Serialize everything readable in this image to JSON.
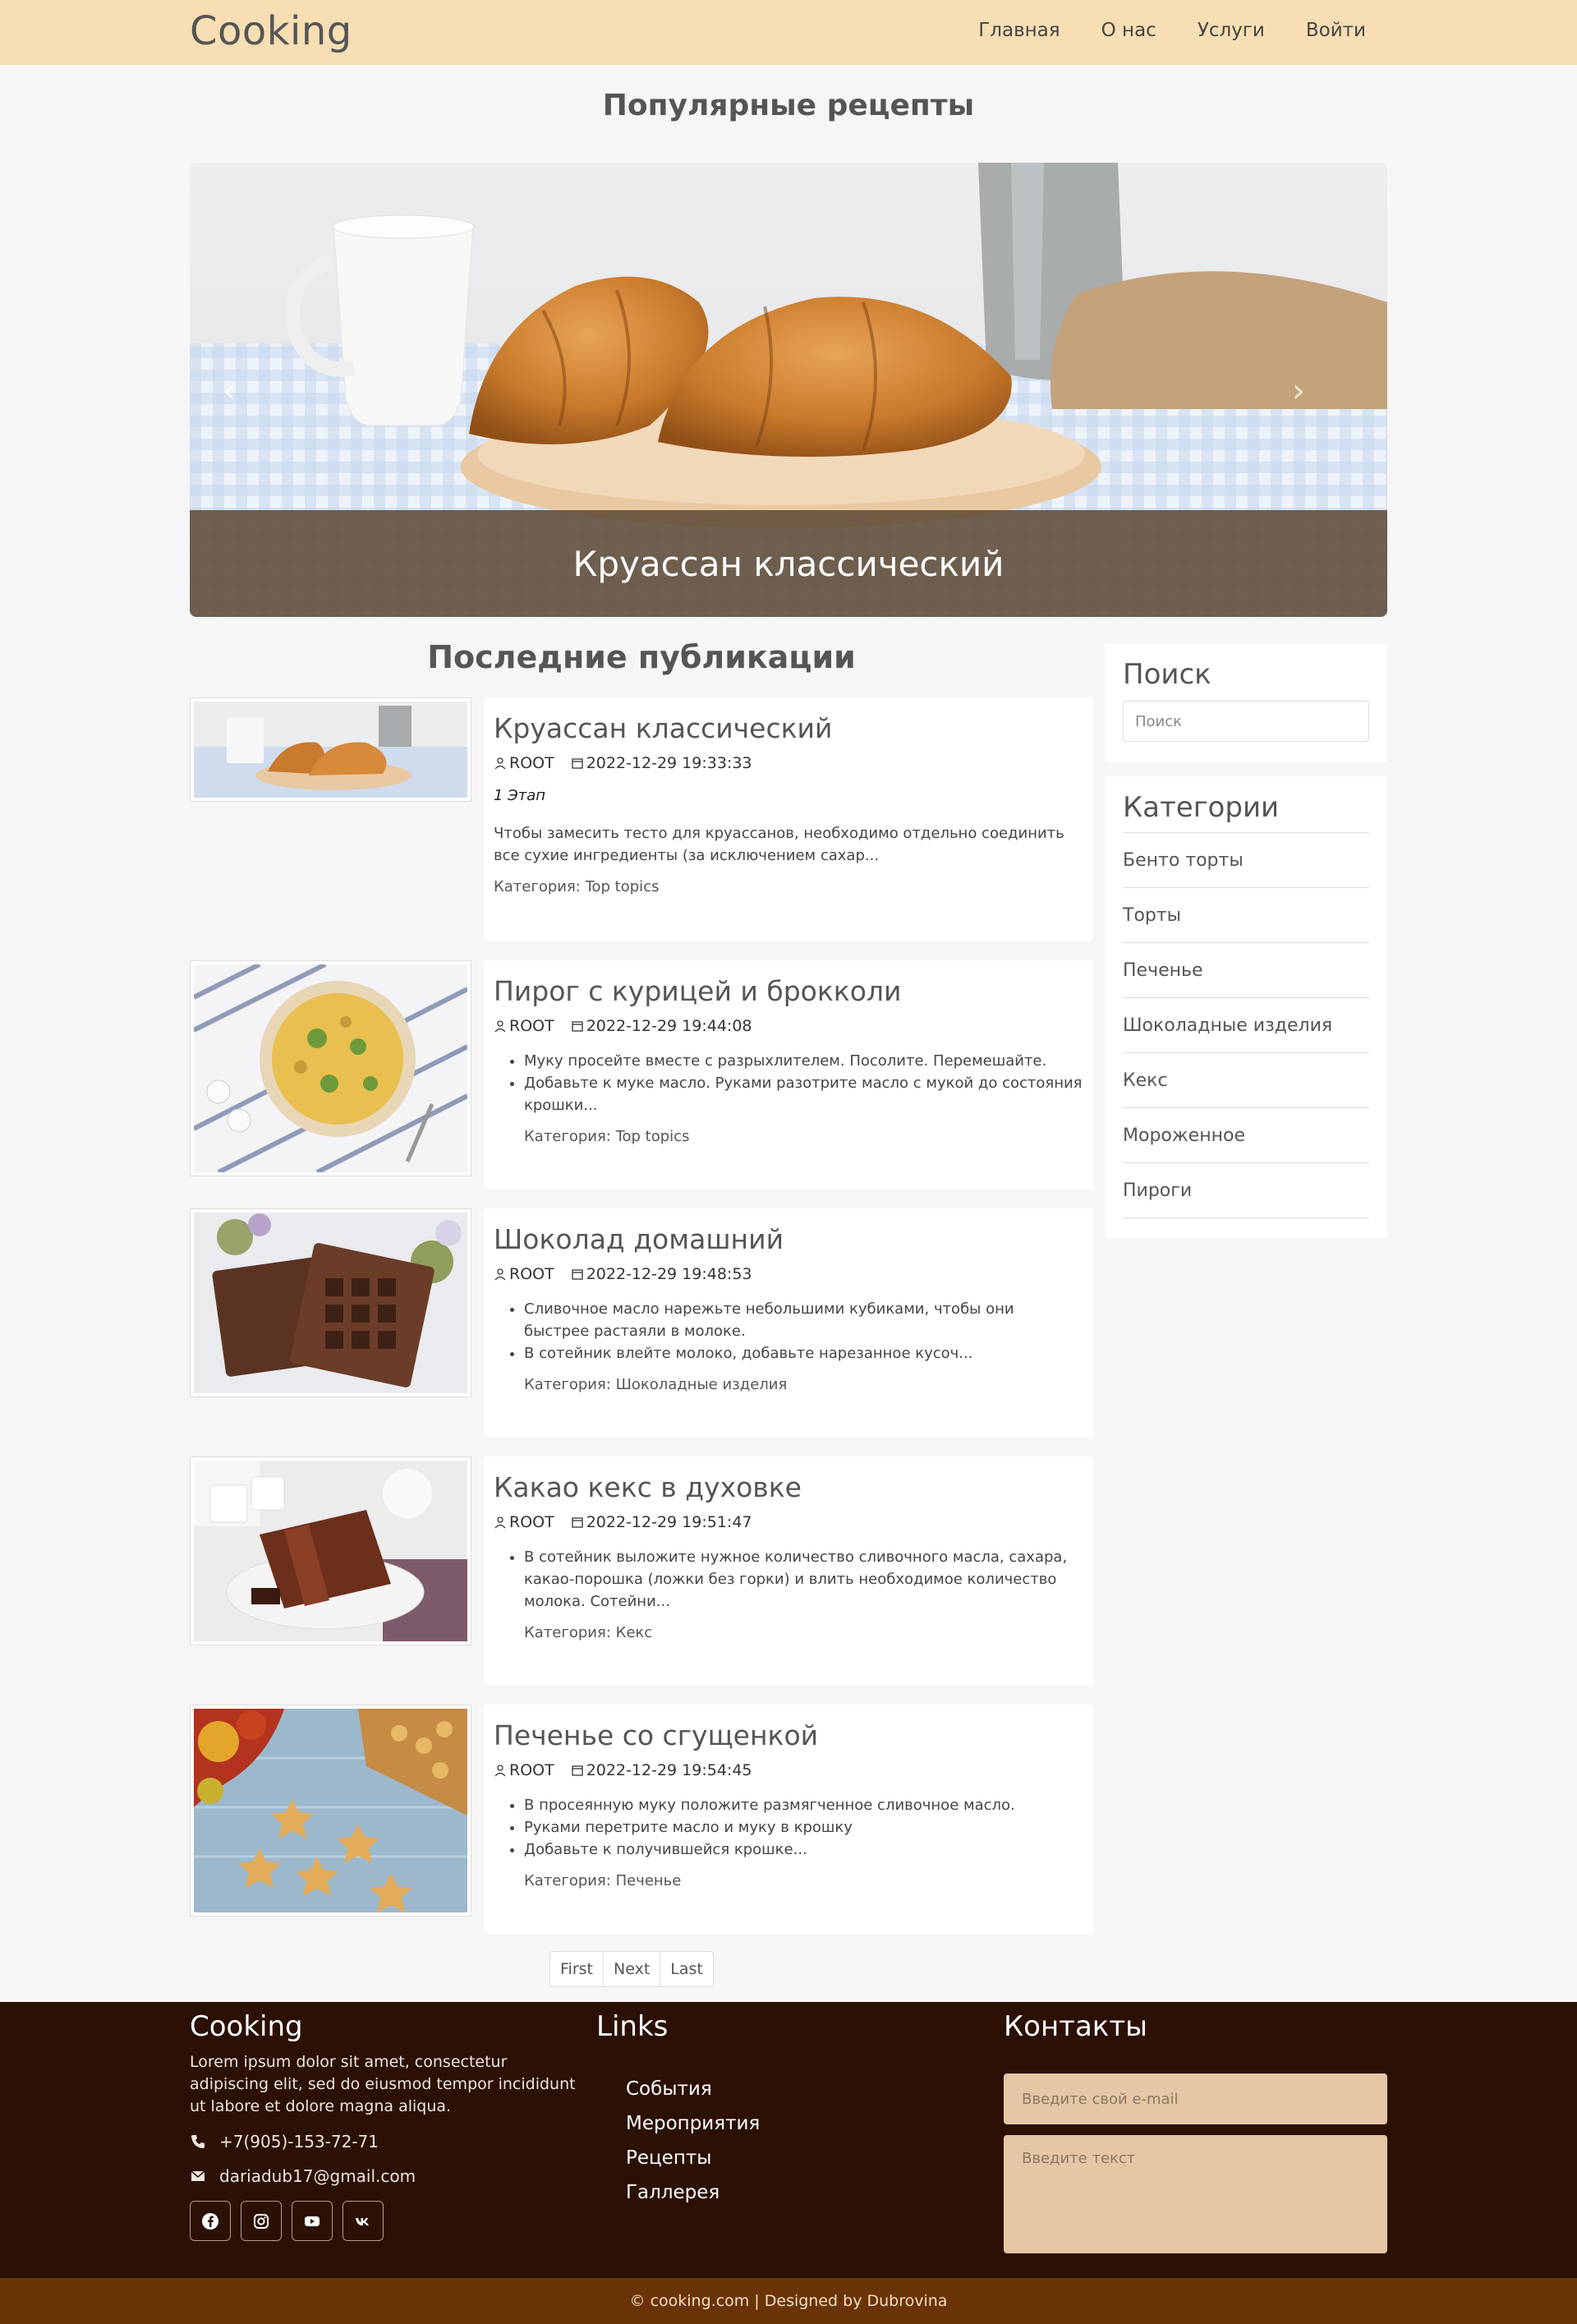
{
  "navbar": {
    "brand": "Cooking",
    "links": [
      "Главная",
      "О нас",
      "Услуги",
      "Войти"
    ]
  },
  "popular": {
    "title": "Популярные рецепты",
    "slide_caption": "Круассан классический"
  },
  "latest_title": "Последние публикации",
  "posts": [
    {
      "title": "Круассан классический",
      "author": "ROOT",
      "date": "2022-12-29 19:33:33",
      "stage": "1 Этап",
      "text": "Чтобы замесить тесто для круассанов, необходимо отдельно соединить все сухие ингредиенты (за исключением сахар...",
      "category": "Категория: Top topics"
    },
    {
      "title": "Пирог с курицей и брокколи",
      "author": "ROOT",
      "date": "2022-12-29 19:44:08",
      "items": [
        "Муку просейте вместе с разрыхлителем. Посолите. Перемешайте.",
        "Добавьте к муке масло. Руками разотрите масло с мукой до состояния крошки..."
      ],
      "category": "Категория: Top topics"
    },
    {
      "title": "Шоколад домашний",
      "author": "ROOT",
      "date": "2022-12-29 19:48:53",
      "items": [
        "Сливочное масло нарежьте небольшими кубиками, чтобы они быстрее растаяли в молоке.",
        "В сотейник влейте молоко, добавьте нарезанное кусоч..."
      ],
      "category": "Категория: Шоколадные изделия"
    },
    {
      "title": "Какао кекс в духовке",
      "author": "ROOT",
      "date": "2022-12-29 19:51:47",
      "items": [
        "В сотейник выложите нужное количество сливочного масла, сахара, какао-порошка (ложки без горки) и влить необходимое количество молока. Сотейни..."
      ],
      "category": "Категория: Кекс"
    },
    {
      "title": "Печенье со сгущенкой",
      "author": "ROOT",
      "date": "2022-12-29 19:54:45",
      "items": [
        "В просеянную муку положите размягченное сливочное масло.",
        "Руками перетрите масло и муку в крошку",
        "Добавьте к получившейся крошке..."
      ],
      "category": "Категория: Печенье"
    }
  ],
  "sidebar": {
    "search_title": "Поиск",
    "search_placeholder": "Поиск",
    "categories_title": "Категории",
    "categories": [
      "Бенто торты",
      "Торты",
      "Печенье",
      "Шоколадные изделия",
      "Кекс",
      "Мороженное",
      "Пироги"
    ]
  },
  "pagination": [
    "First",
    "Next",
    "Last"
  ],
  "footer": {
    "brand": "Cooking",
    "about": "Lorem ipsum dolor sit amet, consectetur adipiscing elit, sed do eiusmod tempor incididunt ut labore et dolore magna aliqua.",
    "phone": "+7(905)-153-72-71",
    "email": "dariadub17@gmail.com",
    "links_title": "Links",
    "links": [
      "События",
      "Мероприятия",
      "Рецепты",
      "Галлерея"
    ],
    "contacts_title": "Контакты",
    "email_placeholder": "Введите свой e-mail",
    "text_placeholder": "Введите текст",
    "social_icons": [
      "facebook-icon",
      "instagram-icon",
      "youtube-icon",
      "vk-icon"
    ]
  },
  "copyright": "© cooking.com | Designed by Dubrovina",
  "colors": {
    "navbar_bg": "#f7deb3",
    "footer_bg": "#2b1003",
    "copyright_bg": "#6a3306",
    "input_bg": "#e5c6a5",
    "page_bg": "#f6f6f6"
  }
}
